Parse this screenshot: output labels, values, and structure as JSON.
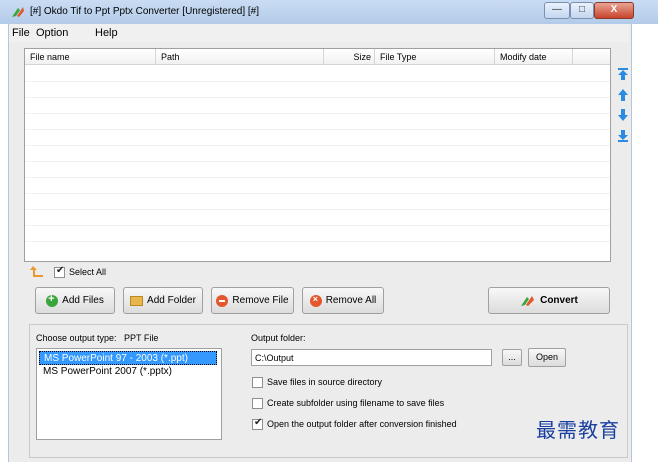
{
  "window": {
    "title": "[#] Okdo Tif to Ppt Pptx Converter [Unregistered] [#]",
    "min_label": "—",
    "max_label": "□",
    "close_label": "X"
  },
  "menu": [
    "File",
    "Option",
    "Help"
  ],
  "file_list": {
    "columns": [
      "File name",
      "Path",
      "Size",
      "File Type",
      "Modify date"
    ]
  },
  "select_all_label": "Select All",
  "buttons": {
    "add_files": "Add Files",
    "add_folder": "Add Folder",
    "remove_file": "Remove File",
    "remove_all": "Remove All",
    "convert": "Convert"
  },
  "output_type": {
    "label": "Choose output type:",
    "current": "PPT File",
    "options": [
      "MS PowerPoint 97 - 2003 (*.ppt)",
      "MS PowerPoint 2007 (*.pptx)"
    ],
    "selected_index": 0
  },
  "output_folder": {
    "label": "Output folder:",
    "value": "C:\\Output",
    "browse_label": "...",
    "open_label": "Open"
  },
  "options": [
    {
      "label": "Save files in source directory",
      "checked": false
    },
    {
      "label": "Create subfolder using filename to save files",
      "checked": false
    },
    {
      "label": "Open the output folder after conversion finished",
      "checked": true
    }
  ],
  "watermark": "最需教育",
  "colors": {
    "titlebar": "#c9dcf3",
    "selection": "#3399ff",
    "arrow": "#2a8be0"
  }
}
